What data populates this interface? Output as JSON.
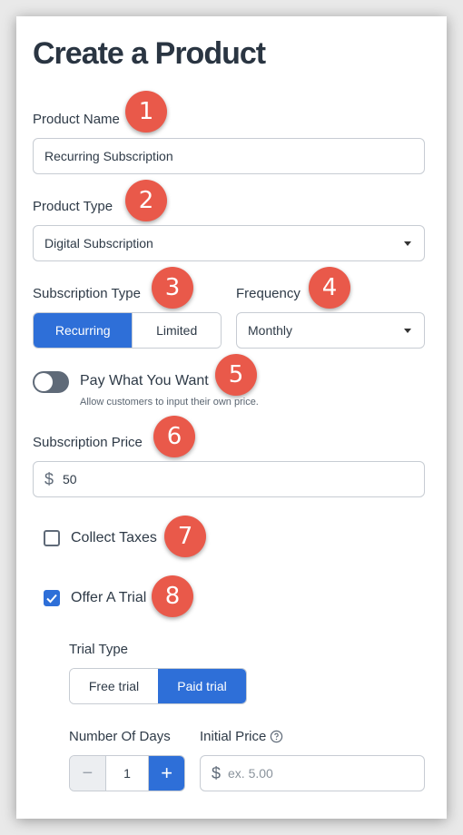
{
  "page": {
    "title": "Create a Product"
  },
  "product_name": {
    "label": "Product Name",
    "value": "Recurring Subscription",
    "badge": "1"
  },
  "product_type": {
    "label": "Product Type",
    "selected": "Digital Subscription",
    "badge": "2"
  },
  "subscription_type": {
    "label": "Subscription Type",
    "options": [
      "Recurring",
      "Limited"
    ],
    "selected": "Recurring",
    "badge": "3"
  },
  "frequency": {
    "label": "Frequency",
    "selected": "Monthly",
    "badge": "4"
  },
  "pay_what_you_want": {
    "label": "Pay What You Want",
    "help": "Allow customers to input their own price.",
    "enabled": false,
    "badge": "5"
  },
  "subscription_price": {
    "label": "Subscription Price",
    "currency_symbol": "$",
    "value": "50",
    "badge": "6"
  },
  "collect_taxes": {
    "label": "Collect Taxes",
    "checked": false,
    "badge": "7"
  },
  "offer_trial": {
    "label": "Offer A Trial",
    "checked": true,
    "badge": "8"
  },
  "trial_type": {
    "label": "Trial Type",
    "options": [
      "Free trial",
      "Paid trial"
    ],
    "selected": "Paid trial"
  },
  "number_of_days": {
    "label": "Number Of Days",
    "value": "1",
    "minus": "−",
    "plus": "+"
  },
  "initial_price": {
    "label": "Initial Price",
    "currency_symbol": "$",
    "placeholder": "ex. 5.00",
    "info_icon": "help-circle-icon"
  },
  "colors": {
    "accent": "#2e6fd8",
    "badge": "#e9594a",
    "toggle_off": "#5f6a78"
  }
}
